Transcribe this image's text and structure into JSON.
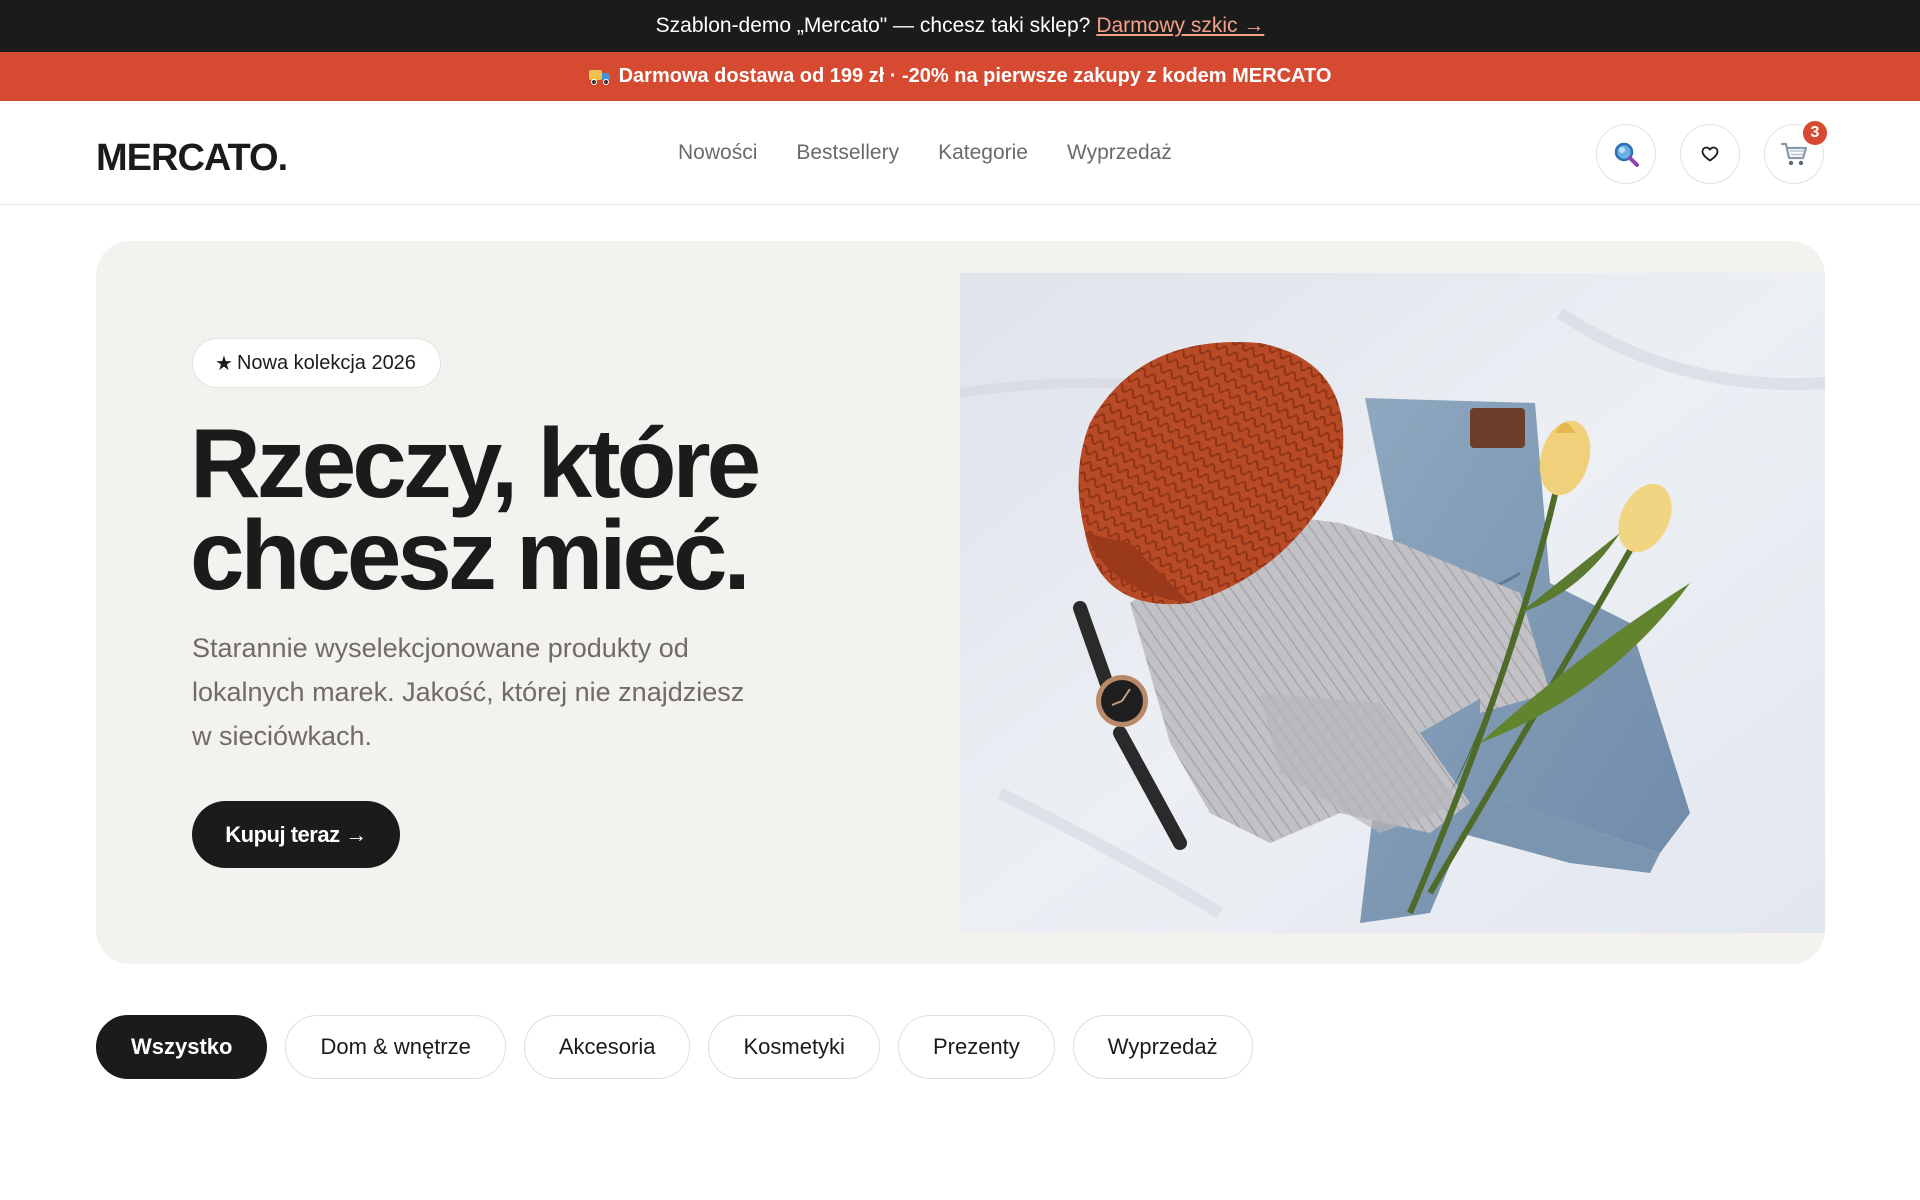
{
  "demo_bar": {
    "text": "Szablon-demo „Mercato\" — chcesz taki sklep?",
    "link": "Darmowy szkic →"
  },
  "promo_bar": {
    "icon": "truck-icon",
    "text": "Darmowa dostawa od 199 zł · -20% na pierwsze zakupy z kodem MERCATO"
  },
  "header": {
    "logo": "MERCATO",
    "logo_dot": ".",
    "nav": [
      "Nowości",
      "Bestsellery",
      "Kategorie",
      "Wyprzedaż"
    ],
    "icons": [
      "search-icon",
      "heart-icon",
      "cart-icon"
    ],
    "cart_count": "3"
  },
  "hero": {
    "badge_icon": "★",
    "badge": "Nowa kolekcja 2026",
    "title_line1": "Rzeczy, które",
    "title_line2": "chcesz mieć.",
    "subtitle": "Starannie wyselekcjonowane produkty od lokalnych marek. Jakość, której nie znajdziesz w sieciówkach.",
    "cta": "Kupuj teraz →",
    "image": "flat-lay-clothing-photo"
  },
  "categories": {
    "items": [
      "Wszystko",
      "Dom & wnętrze",
      "Akcesoria",
      "Kosmetyki",
      "Prezenty",
      "Wyprzedaż"
    ],
    "active": "Wszystko"
  },
  "colors": {
    "accent": "#d64a31",
    "dark": "#1b1b1b",
    "hero_bg": "#f3f2ef"
  }
}
